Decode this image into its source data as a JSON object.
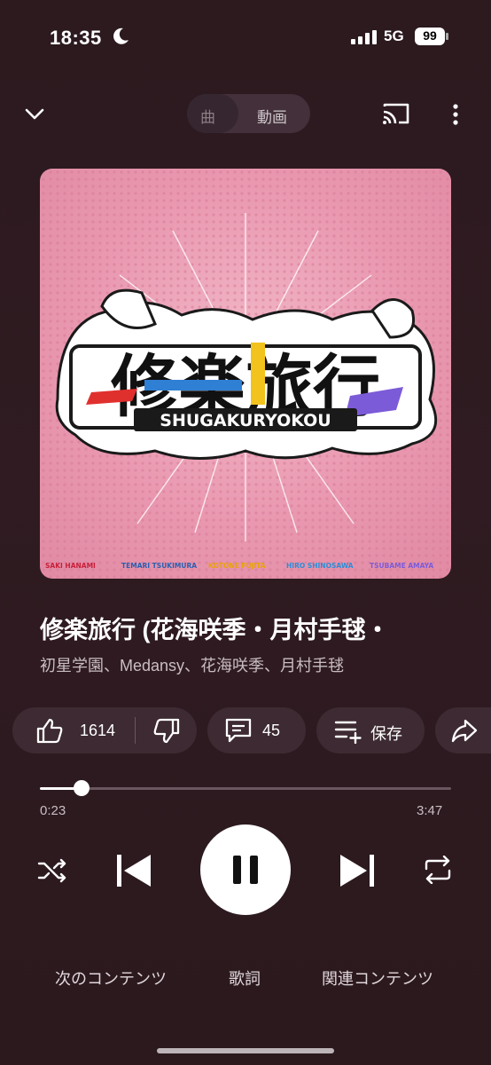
{
  "status_bar": {
    "time": "18:35",
    "network": "5G",
    "battery": "99"
  },
  "top_bar": {
    "song_tab": "曲",
    "video_tab": "動画"
  },
  "album_art": {
    "logo_text": "修楽旅行",
    "subtitle": "SHUGAKURYOKOU",
    "credits": [
      "SAKI HANAMI",
      "TEMARI TSUKIMURA",
      "KOTONE FUJITA",
      "HIRO SHINOSAWA",
      "TSUBAME AMAYA"
    ],
    "colors": {
      "background": "#e998b0",
      "accent_red": "#e0302e",
      "accent_blue": "#2f7fd4",
      "accent_yellow": "#f2c21d",
      "accent_purple": "#7c5bd8"
    }
  },
  "track": {
    "title": "修楽旅行 (花海咲季・月村手毬・",
    "artists": "初星学園、Medansy、花海咲季、月村手毬"
  },
  "actions": {
    "likes": "1614",
    "comments": "45",
    "save": "保存"
  },
  "playback": {
    "current_time": "0:23",
    "total_time": "3:47",
    "progress": 0.101
  },
  "bottom_tabs": {
    "up_next": "次のコンテンツ",
    "lyrics": "歌詞",
    "related": "関連コンテンツ"
  }
}
